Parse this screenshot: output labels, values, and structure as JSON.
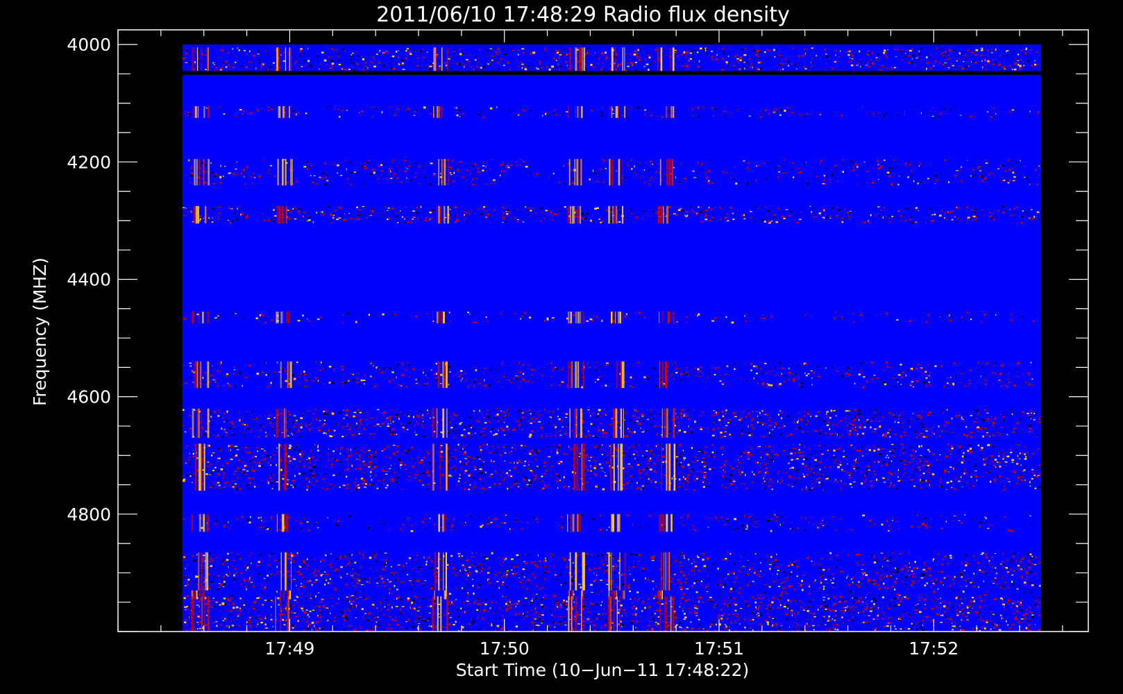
{
  "chart_data": {
    "type": "heatmap",
    "title": "2011/06/10 17:48:29 Radio flux density",
    "xlabel": "Start Time (10−Jun−11 17:48:22)",
    "ylabel": "Frequency (MHZ)",
    "x_ticks": [
      "17:49",
      "17:50",
      "17:51",
      "17:52"
    ],
    "y_ticks": [
      "4000",
      "4200",
      "4400",
      "4600",
      "4800"
    ],
    "x_range_minutes": [
      1048.2,
      1052.72
    ],
    "x_tick_minutes": [
      1049,
      1050,
      1051,
      1052
    ],
    "data_x_range_minutes": [
      1048.5,
      1052.5
    ],
    "ylim": [
      3975,
      5000
    ],
    "y_tick_values": [
      4000,
      4200,
      4400,
      4600,
      4800
    ],
    "data_y_range": [
      4000,
      5000
    ],
    "background_color": "#0000ff",
    "colors": {
      "background": "#000000",
      "axes": "#ffffff",
      "low": "#0000ff",
      "mid": "#cc0000",
      "high": "#ffcc33",
      "dropout": "#000010"
    },
    "bands": [
      {
        "f0": 4005,
        "f1": 4045,
        "intensity": 0.55
      },
      {
        "f0": 4045,
        "f1": 4052,
        "intensity": -1
      },
      {
        "f0": 4105,
        "f1": 4125,
        "intensity": 0.25
      },
      {
        "f0": 4195,
        "f1": 4240,
        "intensity": 0.3
      },
      {
        "f0": 4275,
        "f1": 4305,
        "intensity": 0.5
      },
      {
        "f0": 4455,
        "f1": 4475,
        "intensity": 0.2
      },
      {
        "f0": 4540,
        "f1": 4585,
        "intensity": 0.35
      },
      {
        "f0": 4620,
        "f1": 4670,
        "intensity": 0.6
      },
      {
        "f0": 4680,
        "f1": 4760,
        "intensity": 0.6
      },
      {
        "f0": 4800,
        "f1": 4830,
        "intensity": 0.25
      },
      {
        "f0": 4865,
        "f1": 4930,
        "intensity": 0.55
      },
      {
        "f0": 4930,
        "f1": 4945,
        "intensity": 0.2
      },
      {
        "f0": 4940,
        "f1": 5000,
        "intensity": 0.7
      }
    ],
    "bursts_minutes": [
      1048.58,
      1048.97,
      1049.7,
      1050.33,
      1050.52,
      1050.75
    ],
    "grid": false
  }
}
